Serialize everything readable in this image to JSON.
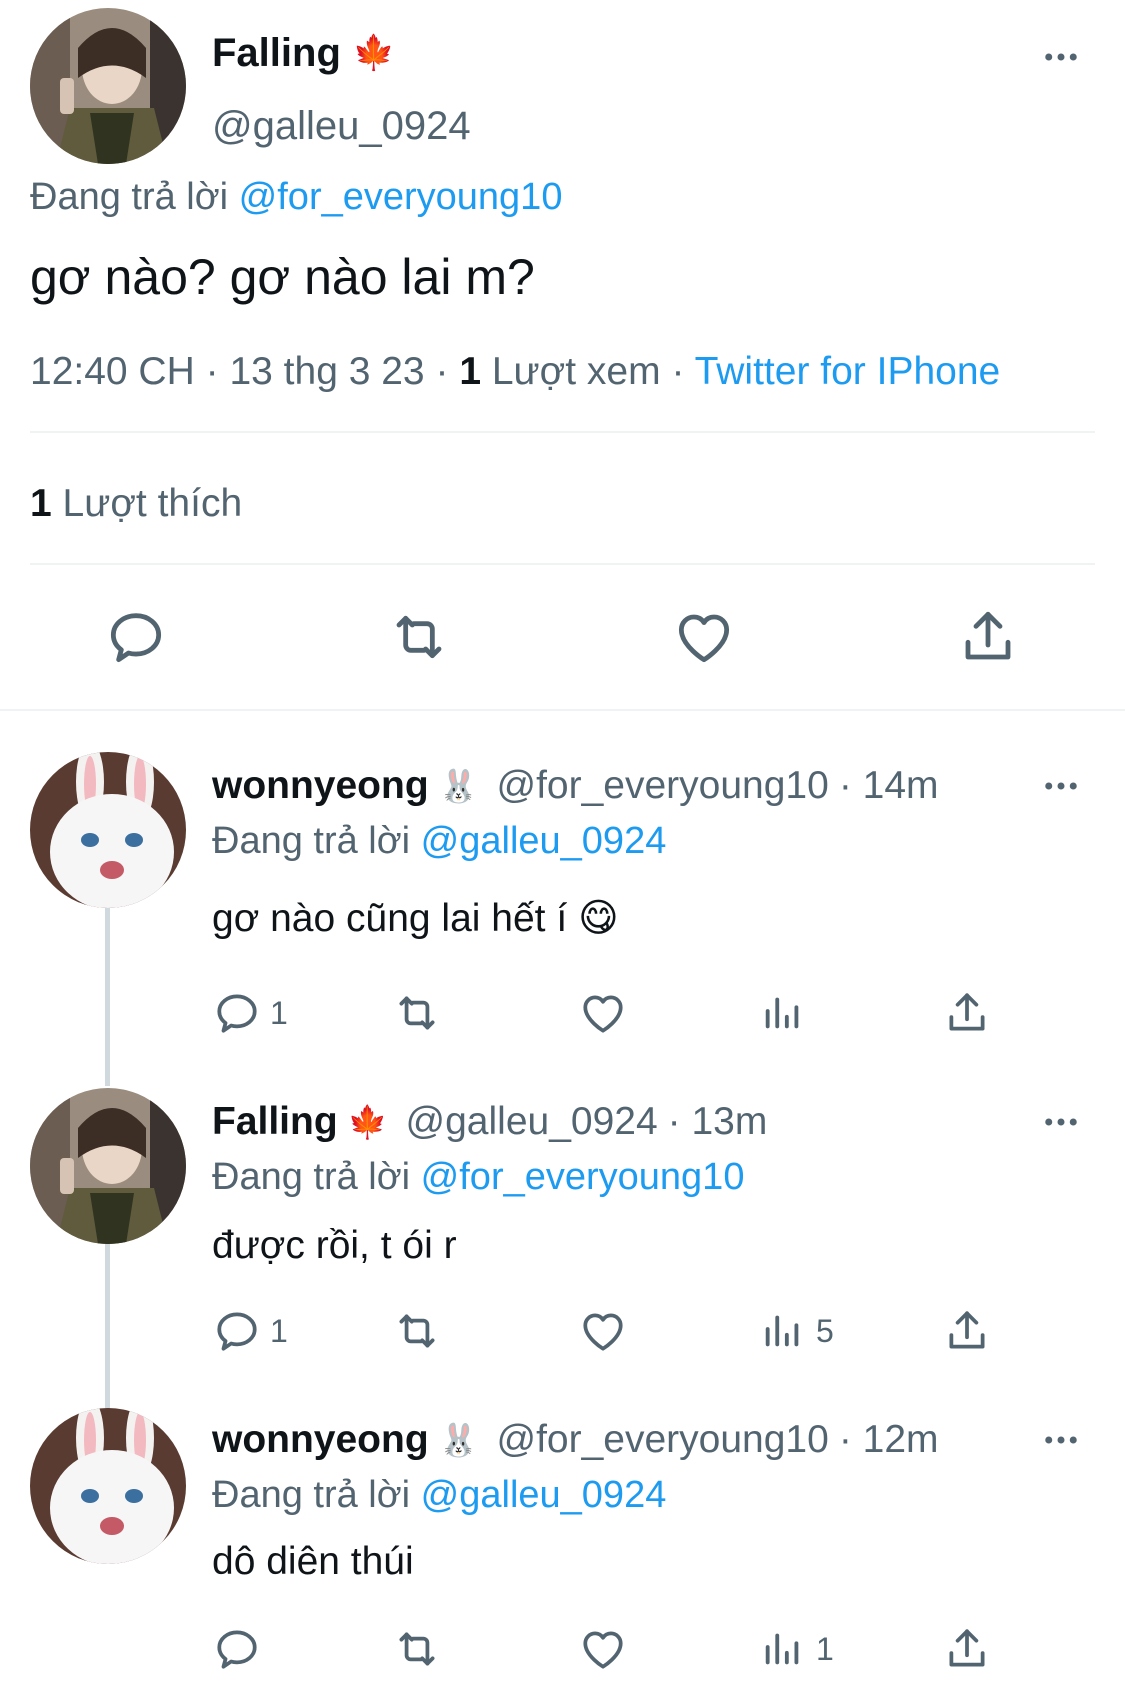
{
  "main_tweet": {
    "display_name": "Falling",
    "name_emoji": "🍁",
    "handle": "@galleu_0924",
    "reply_prefix": "Đang trả lời",
    "reply_to": "@for_everyoung10",
    "text": "gơ nào? gơ nào lai m?",
    "time": "12:40 CH",
    "date": "13 thg 3 23",
    "views_count": "1",
    "views_label": "Lượt xem",
    "source": "Twitter for IPhone",
    "likes_count": "1",
    "likes_label": "Lượt thích",
    "sep": "·"
  },
  "replies": [
    {
      "display_name": "wonnyeong",
      "name_emoji": "🐰",
      "handle": "@for_everyoung10",
      "age": "· 14m",
      "reply_prefix": "Đang trả lời",
      "reply_to": "@galleu_0924",
      "text": "gơ nào cũng lai hết í 😋",
      "reply_count": "1",
      "view_count": ""
    },
    {
      "display_name": "Falling",
      "name_emoji": "🍁",
      "handle": "@galleu_0924",
      "age": "· 13m",
      "reply_prefix": "Đang trả lời",
      "reply_to": "@for_everyoung10",
      "text": "được rồi, t ói r",
      "reply_count": "1",
      "view_count": "5"
    },
    {
      "display_name": "wonnyeong",
      "name_emoji": "🐰",
      "handle": "@for_everyoung10",
      "age": "· 12m",
      "reply_prefix": "Đang trả lời",
      "reply_to": "@galleu_0924",
      "text": "dô diên thúi",
      "reply_count": "",
      "view_count": "1"
    }
  ],
  "colors": {
    "link": "#1d9bf0",
    "muted": "#536471",
    "text": "#0f1419",
    "divider": "#eff3f4"
  }
}
